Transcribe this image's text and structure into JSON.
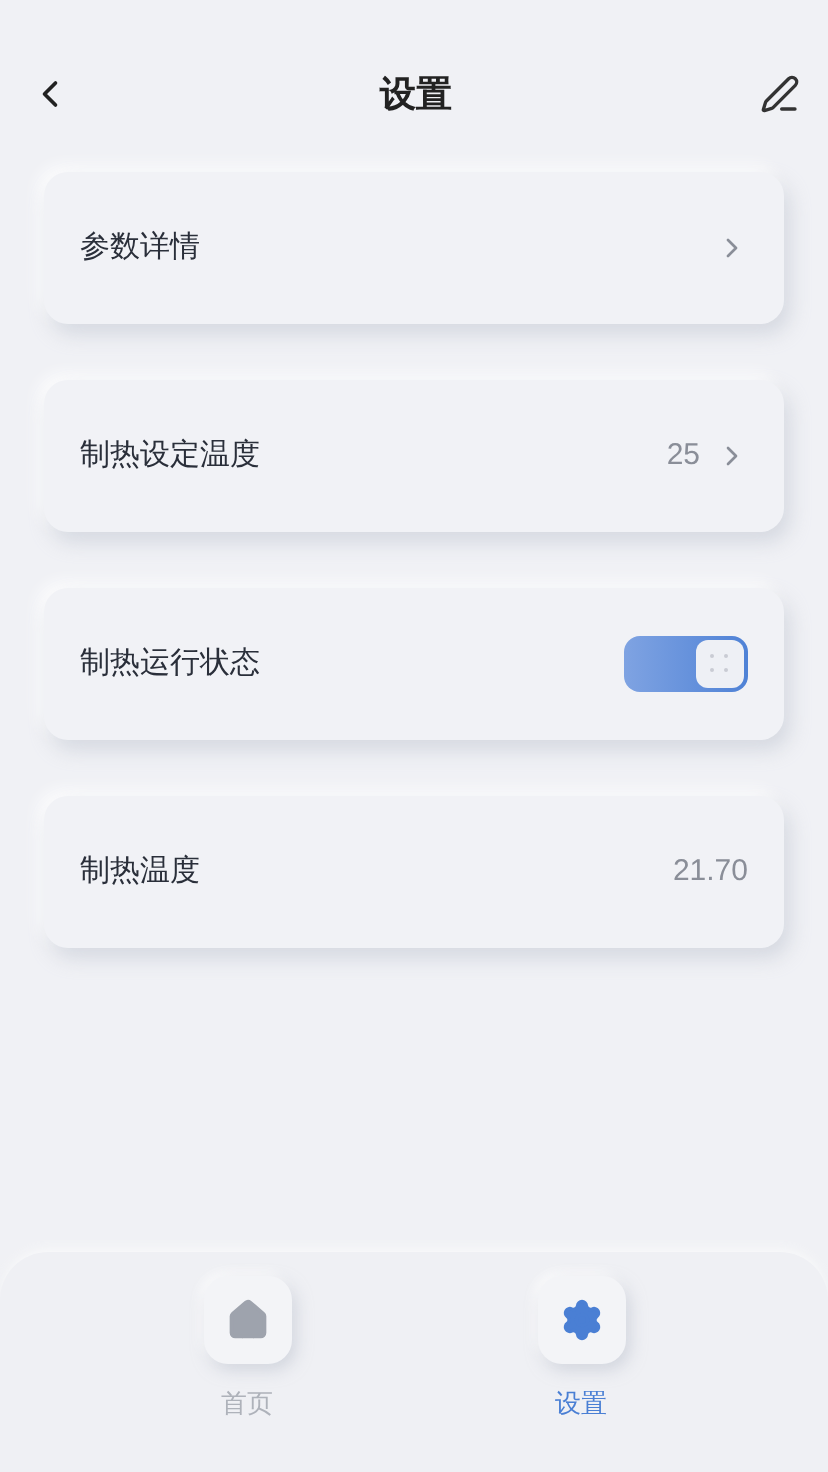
{
  "header": {
    "title": "设置"
  },
  "rows": [
    {
      "kind": "link",
      "label": "参数详情"
    },
    {
      "kind": "link",
      "label": "制热设定温度",
      "value": "25"
    },
    {
      "kind": "toggle",
      "label": "制热运行状态",
      "on": true
    },
    {
      "kind": "value",
      "label": "制热温度",
      "value": "21.70"
    }
  ],
  "tabbar": [
    {
      "kind": "home",
      "label": "首页",
      "selected": false
    },
    {
      "kind": "settings",
      "label": "设置",
      "selected": true
    }
  ]
}
